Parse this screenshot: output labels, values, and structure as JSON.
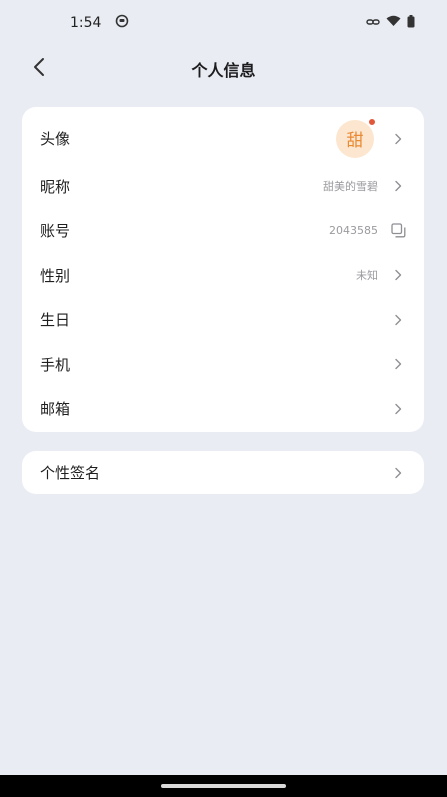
{
  "status_bar": {
    "time": "1:54"
  },
  "header": {
    "title": "个人信息"
  },
  "profile": {
    "avatar": {
      "label": "头像",
      "text": "甜"
    },
    "nickname": {
      "label": "昵称",
      "value": "甜美的雪碧"
    },
    "account": {
      "label": "账号",
      "value": "2043585"
    },
    "gender": {
      "label": "性别",
      "value": "未知"
    },
    "birthday": {
      "label": "生日"
    },
    "phone": {
      "label": "手机"
    },
    "email": {
      "label": "邮箱"
    }
  },
  "signature": {
    "label": "个性签名"
  },
  "colors": {
    "background": "#e9edf3",
    "avatar_bg": "#fde6cf",
    "avatar_text": "#e98a34",
    "badge_dot": "#e0573a"
  }
}
